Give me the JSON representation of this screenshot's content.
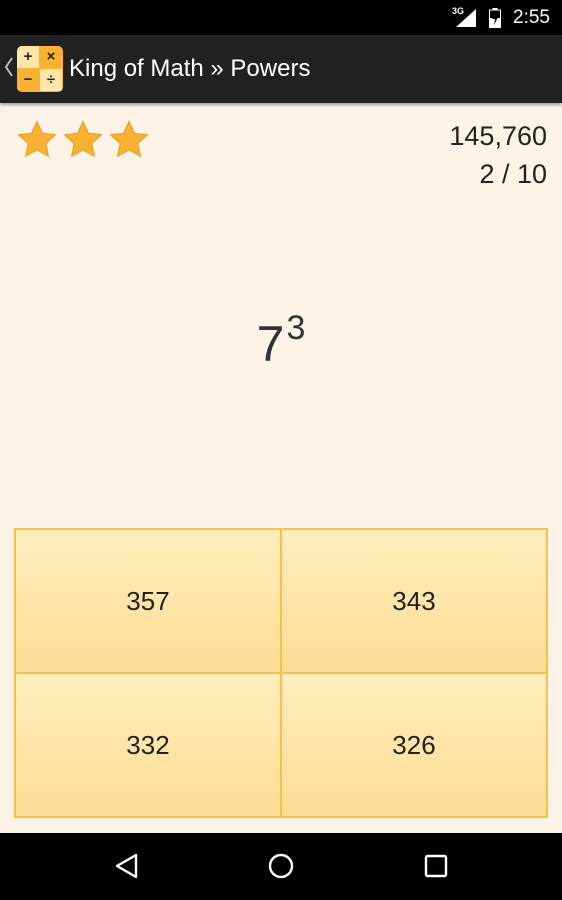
{
  "status_bar": {
    "network": "3G",
    "time": "2:55"
  },
  "action_bar": {
    "title": "King of Math » Powers",
    "icon_symbols": [
      "+",
      "×",
      "−",
      "÷"
    ]
  },
  "game": {
    "stars_earned": 3,
    "stars_total": 3,
    "score": "145,760",
    "progress": "2 / 10"
  },
  "question": {
    "base": "7",
    "exponent": "3"
  },
  "answers": [
    "357",
    "343",
    "332",
    "326"
  ],
  "colors": {
    "background": "#faf3e6",
    "action_bar": "#212121",
    "star": "#fcb133",
    "answer_fill": "#fddc93",
    "answer_border": "#f7bf4c"
  },
  "nav_bar": {
    "icons": [
      "back-icon",
      "home-icon",
      "recents-icon"
    ]
  }
}
